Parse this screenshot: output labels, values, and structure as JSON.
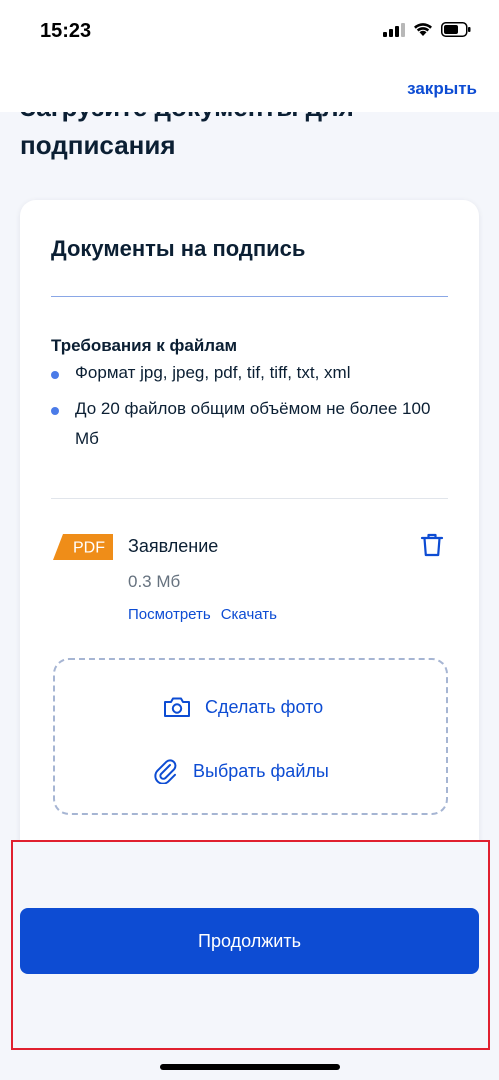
{
  "status": {
    "time": "15:23",
    "icons": [
      "signal-icon",
      "wifi-icon",
      "battery-icon"
    ]
  },
  "nav": {
    "close_label": "закрыть"
  },
  "page": {
    "title": "Загрузите документы для подписания"
  },
  "card": {
    "title": "Документы на подпись",
    "requirements_title": "Требования к файлам",
    "requirements": [
      "Формат jpg, jpeg, pdf, tif, tiff, txt, xml",
      "До 20 файлов общим объёмом не более 100 Мб"
    ],
    "file": {
      "badge": "PDF",
      "name": "Заявление",
      "size": "0.3 Мб",
      "view_label": "Посмотреть",
      "download_label": "Скачать",
      "delete_icon": "trash-icon"
    },
    "dropzone": {
      "photo_label": "Сделать фото",
      "photo_icon": "camera-icon",
      "files_label": "Выбрать файлы",
      "files_icon": "paperclip-icon"
    }
  },
  "footer": {
    "continue_label": "Продолжить"
  },
  "colors": {
    "accent": "#0d4cd3",
    "badge": "#ef8d18",
    "highlight": "#e0202f",
    "background": "#f4f6fb"
  }
}
